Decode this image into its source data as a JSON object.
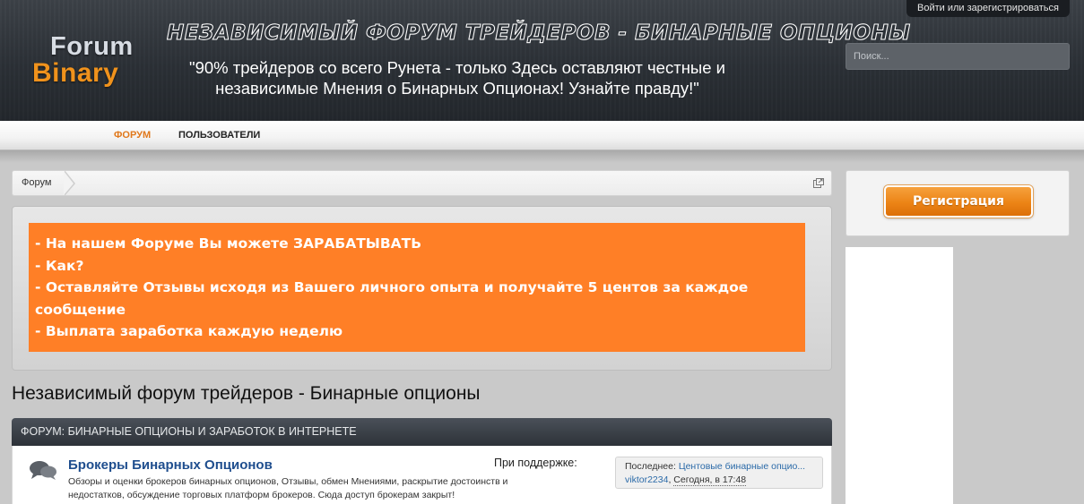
{
  "header": {
    "login_link": "Войти или зарегистрироваться",
    "logo_line1": "Forum",
    "logo_line2": "Binary",
    "site_title": "НЕЗАВИСИМЫЙ ФОРУМ ТРЕЙДЕРОВ - БИНАРНЫЕ ОПЦИОНЫ",
    "slogan_line1": "\"90% трейдеров со всего Рунета - только Здесь оставляют честные и",
    "slogan_line2": "независимые Мнения о Бинарных Опционах! Узнайте правду!\"",
    "search_placeholder": "Поиск..."
  },
  "nav": {
    "items": [
      {
        "label": "Форум",
        "active": true
      },
      {
        "label": "Пользователи",
        "active": false
      }
    ]
  },
  "breadcrumb": {
    "items": [
      "Форум"
    ]
  },
  "promo": {
    "lines": [
      "- На нашем Форуме Вы можете ЗАРАБАТЫВАТЬ",
      "- Как?",
      "- Оставляйте Отзывы исходя из Вашего личного опыта и получайте 5 центов за каждое",
      "сообщение",
      "- Выплата заработка каждую неделю"
    ],
    "color": "#ff7f26"
  },
  "main": {
    "title": "Независимый форум трейдеров - Бинарные опционы",
    "category": "Форум: Бинарные опционы и заработок в интернете",
    "node": {
      "title": "Брокеры Бинарных Опционов",
      "description_line1": "Обзоры и оценки брокеров бинарных опционов, Отзывы, обмен Мнениями, раскрытие достоинств и",
      "description_line2": "недостатков, обсуждение торговых платформ брокеров. Сюда доступ брокерам закрыт!",
      "sponsor_label": "При поддержке:",
      "last_post_label": "Последнее:",
      "last_post_thread": "Центовые бинарные опцио...",
      "last_post_user": "viktor2234",
      "last_post_date": "Сегодня, в 17:48"
    }
  },
  "sidebar": {
    "register_button": "Регистрация"
  },
  "colors": {
    "accent": "#e0781b",
    "header_bg": "#2b3036",
    "link": "#1f4e8e"
  }
}
